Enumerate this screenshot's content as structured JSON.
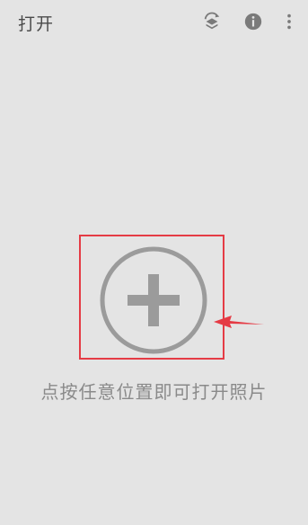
{
  "header": {
    "title": "打开"
  },
  "icons": {
    "layers": "layers-refresh-icon",
    "info": "info-icon",
    "more": "more-vert-icon",
    "add": "add-circle-icon",
    "arrow": "arrow-pointer-icon"
  },
  "main": {
    "hint": "点按任意位置即可打开照片"
  },
  "colors": {
    "background": "#e4e4e4",
    "icon": "#7a7a7a",
    "plus": "#9b9b9b",
    "annotation": "#e53b45"
  }
}
